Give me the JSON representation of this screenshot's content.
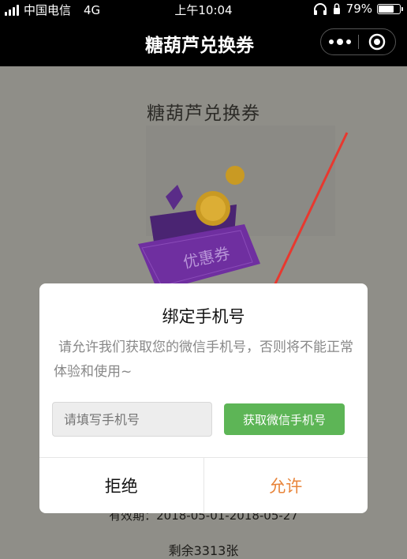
{
  "status_bar": {
    "carrier": "中国电信",
    "network": "4G",
    "time": "上午10:04",
    "battery_text": "79%",
    "battery_level": 0.79
  },
  "navbar": {
    "title": "糖葫芦兑换券",
    "more_icon": "more-dots-icon",
    "close_icon": "target-close-icon"
  },
  "page": {
    "title": "糖葫芦兑换券",
    "coupon_label": "优惠券",
    "validity": "有效期：2018-05-01-2018-05-27",
    "remaining": "剩余3313张"
  },
  "dialog": {
    "title": "绑定手机号",
    "message": "请允许我们获取您的微信手机号，否则将不能正常体验和使用~",
    "phone_placeholder": "请填写手机号",
    "get_phone_button": "获取微信手机号",
    "reject_label": "拒绝",
    "allow_label": "允许"
  },
  "colors": {
    "allow": "#e8843a",
    "get_button": "#5db556",
    "arrow": "#e8382f",
    "coupon": "#6f2fa0"
  }
}
